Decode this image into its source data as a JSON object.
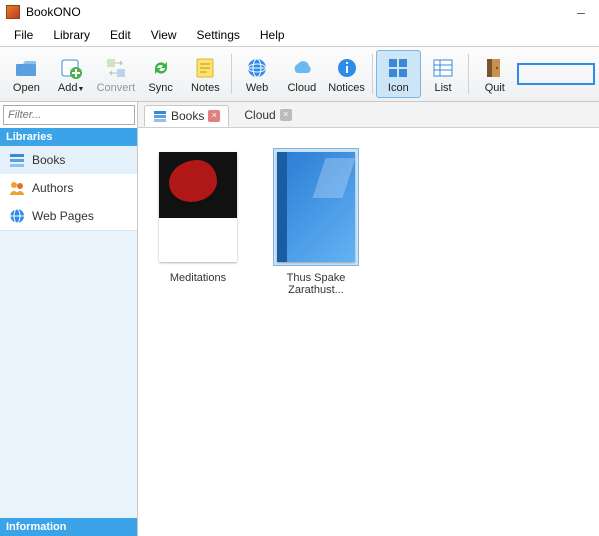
{
  "app": {
    "title": "BookONO"
  },
  "menu": {
    "items": [
      "File",
      "Library",
      "Edit",
      "View",
      "Settings",
      "Help"
    ]
  },
  "toolbar": {
    "items": [
      {
        "id": "open",
        "label": "Open",
        "active": false,
        "disabled": false
      },
      {
        "id": "add",
        "label": "Add",
        "active": false,
        "disabled": false,
        "dropdown": true
      },
      {
        "id": "convert",
        "label": "Convert",
        "active": false,
        "disabled": true
      },
      {
        "id": "sync",
        "label": "Sync",
        "active": false,
        "disabled": false
      },
      {
        "id": "notes",
        "label": "Notes",
        "active": false,
        "disabled": false
      },
      {
        "id": "web",
        "label": "Web",
        "active": false,
        "disabled": false
      },
      {
        "id": "cloud",
        "label": "Cloud",
        "active": false,
        "disabled": false
      },
      {
        "id": "notices",
        "label": "Notices",
        "active": false,
        "disabled": false
      },
      {
        "id": "icon",
        "label": "Icon",
        "active": true,
        "disabled": false
      },
      {
        "id": "list",
        "label": "List",
        "active": false,
        "disabled": false
      },
      {
        "id": "quit",
        "label": "Quit",
        "active": false,
        "disabled": false
      }
    ]
  },
  "sidebar": {
    "filter_placeholder": "Filter...",
    "section_libraries": "Libraries",
    "section_information": "Information",
    "items": [
      {
        "id": "books",
        "label": "Books",
        "selected": true
      },
      {
        "id": "authors",
        "label": "Authors",
        "selected": false
      },
      {
        "id": "webpages",
        "label": "Web Pages",
        "selected": false
      }
    ]
  },
  "tabs": [
    {
      "id": "books",
      "label": "Books",
      "active": true
    },
    {
      "id": "cloud",
      "label": "Cloud",
      "active": false
    }
  ],
  "books": [
    {
      "id": "meditations",
      "title": "Meditations",
      "selected": false
    },
    {
      "id": "zarathustra",
      "title": "Thus Spake Zarathust...",
      "selected": true
    }
  ]
}
